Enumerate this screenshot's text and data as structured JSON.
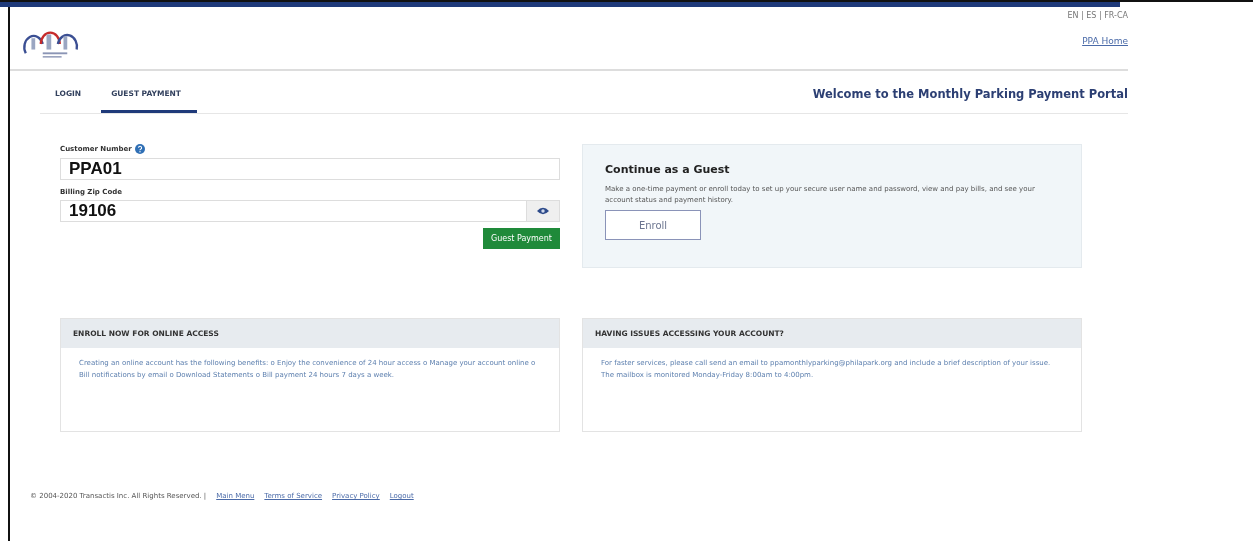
{
  "header": {
    "languages": "EN | ES | FR-CA",
    "home_link": "PPA Home"
  },
  "tabs": [
    {
      "label": "LOGIN",
      "selected": false
    },
    {
      "label": "GUEST PAYMENT",
      "selected": true
    }
  ],
  "welcome": "Welcome to the Monthly Parking Payment Portal",
  "form": {
    "customer_label": "Customer Number",
    "customer_value": "PPA01",
    "zip_label": "Billing Zip Code",
    "zip_value": "19106",
    "submit": "Guest Payment"
  },
  "guest_card": {
    "title": "Continue as a Guest",
    "text": "Make a one-time payment or enroll today to set up your secure user name and password, view and pay bills, and see your account status and payment history.",
    "button": "Enroll"
  },
  "info_boxes": [
    {
      "heading": "ENROLL NOW FOR ONLINE ACCESS",
      "text": "Creating an online account has the following benefits: o Enjoy the convenience of 24 hour access o Manage your account online o Bill notifications by email o Download Statements o Bill payment 24 hours 7 days a week."
    },
    {
      "heading": "HAVING ISSUES ACCESSING YOUR ACCOUNT?",
      "text": "For faster services, please call send an email to ppamonthlyparking@philapark.org and include a brief description of your issue. The mailbox is monitored Monday-Friday 8:00am to 4:00pm."
    }
  ],
  "footer": {
    "copyright": "© 2004-2020 Transactis Inc. All Rights Reserved. |",
    "links": [
      "Main Menu",
      "Terms of Service",
      "Privacy Policy",
      "Logout"
    ]
  }
}
